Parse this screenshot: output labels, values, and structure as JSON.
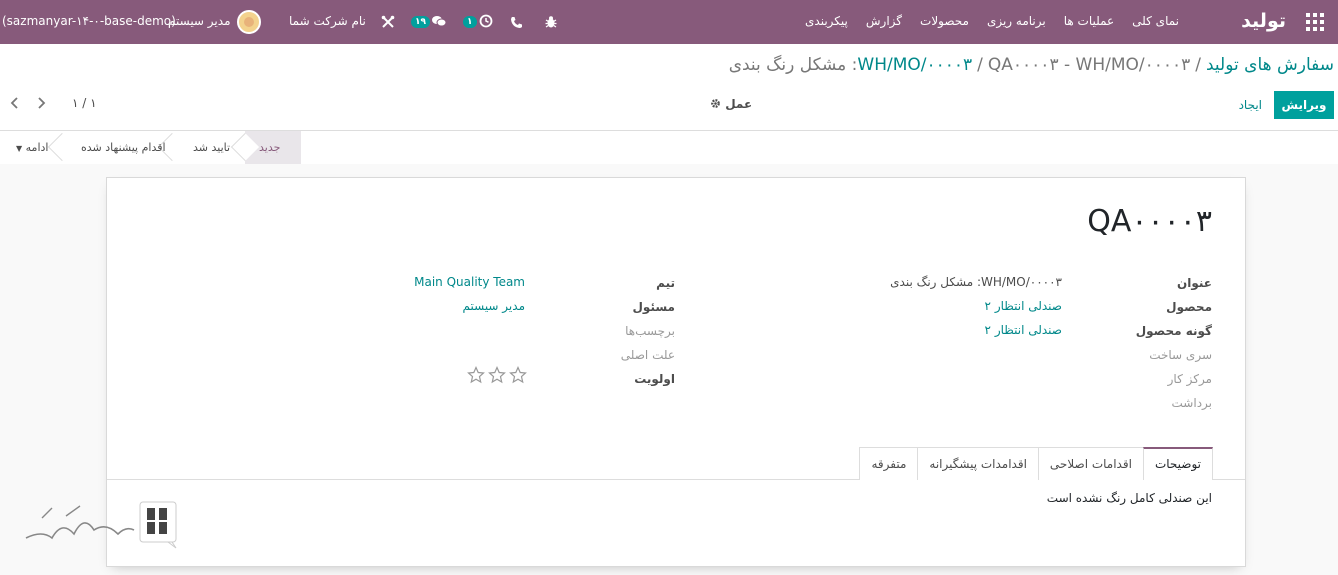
{
  "navbar": {
    "brand": "تولید",
    "menu": [
      "نمای کلی",
      "عملیات ها",
      "برنامه ریزی",
      "محصولات",
      "گزارش",
      "پیکربندی"
    ],
    "chat_count": "۱۹",
    "activity_count": "۱",
    "company": "نام شرکت شما",
    "user": "مدیر سیستم",
    "database": "(sazmanyar-۱۴-۰-base-demo)"
  },
  "breadcrumb": {
    "root": "سفارش های تولید",
    "parent": "WH/MO/۰۰۰۰۳",
    "current": "QA۰۰۰۰۳ - WH/MO/۰۰۰۰۳: مشکل رنگ بندی"
  },
  "controls": {
    "edit_label": "ویرایش",
    "create_label": "ایجاد",
    "action_label": "عمل",
    "pager": "۱ / ۱"
  },
  "statusbar": {
    "stages": [
      "جدید",
      "تایید شد",
      "اقدام پیشنهاد شده"
    ],
    "current": "جدید",
    "more_label": "ادامه"
  },
  "record": {
    "title": "QA۰۰۰۰۳",
    "left_fields": [
      {
        "label": "عنوان",
        "value": "WH/MO/۰۰۰۰۳: مشکل رنگ بندی",
        "muted": false,
        "link": false
      },
      {
        "label": "محصول",
        "value": "صندلی انتظار ۲",
        "muted": false,
        "link": true
      },
      {
        "label": "گونه محصول",
        "value": "صندلی انتظار ۲",
        "muted": false,
        "link": true
      },
      {
        "label": "سری ساخت",
        "value": "",
        "muted": true,
        "link": false
      },
      {
        "label": "مرکز کار",
        "value": "",
        "muted": true,
        "link": false
      },
      {
        "label": "برداشت",
        "value": "",
        "muted": true,
        "link": false
      }
    ],
    "right_fields": [
      {
        "label": "تیم",
        "value": "Main Quality Team",
        "muted": false,
        "link": true
      },
      {
        "label": "مسئول",
        "value": "مدیر سیستم",
        "muted": false,
        "link": true
      },
      {
        "label": "برچسب‌ها",
        "value": "",
        "muted": true,
        "link": false
      },
      {
        "label": "علت اصلی",
        "value": "",
        "muted": true,
        "link": false
      },
      {
        "label": "اولویت",
        "value": "",
        "muted": false,
        "link": false
      }
    ],
    "priority_stars": 3,
    "priority_value": 0
  },
  "notebook": {
    "tabs": [
      "توضیحات",
      "اقدامات اصلاحی",
      "اقدامدات پیشگیرانه",
      "متفرقه"
    ],
    "active": "توضیحات",
    "content": "این صندلی کامل رنگ نشده است"
  },
  "colors": {
    "brand": "#875a7b",
    "primary": "#00a09d",
    "link": "#00888a"
  }
}
